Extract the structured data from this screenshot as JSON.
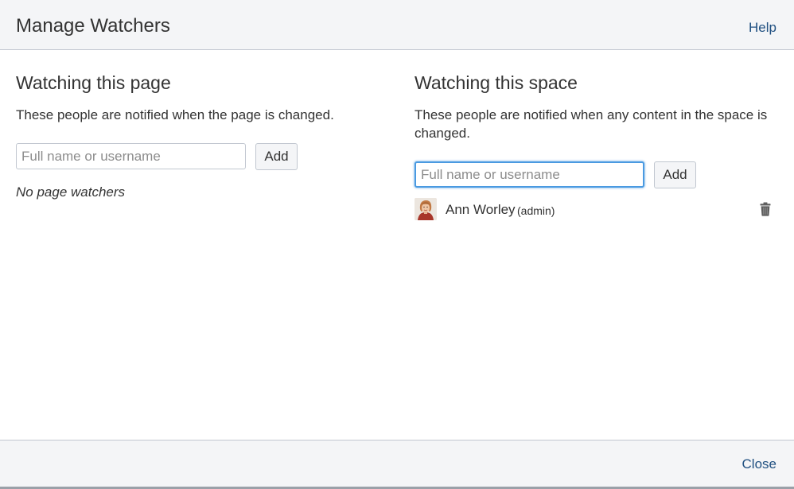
{
  "dialog": {
    "title": "Manage Watchers",
    "help_label": "Help",
    "close_label": "Close"
  },
  "page_section": {
    "heading": "Watching this page",
    "description": "These people are notified when the page is changed.",
    "input_placeholder": "Full name or username",
    "input_value": "",
    "add_label": "Add",
    "empty_text": "No page watchers"
  },
  "space_section": {
    "heading": "Watching this space",
    "description": "These people are notified when any content in the space is changed.",
    "input_placeholder": "Full name or username",
    "input_value": "",
    "add_label": "Add",
    "watchers": [
      {
        "name": "Ann Worley",
        "role": "(admin)",
        "avatar": "user-photo",
        "remove_icon": "trash-icon"
      }
    ]
  },
  "colors": {
    "link": "#205081",
    "focus_ring": "#4a9ae1",
    "header_bg": "#f4f5f7",
    "border": "#c1c7d0"
  }
}
